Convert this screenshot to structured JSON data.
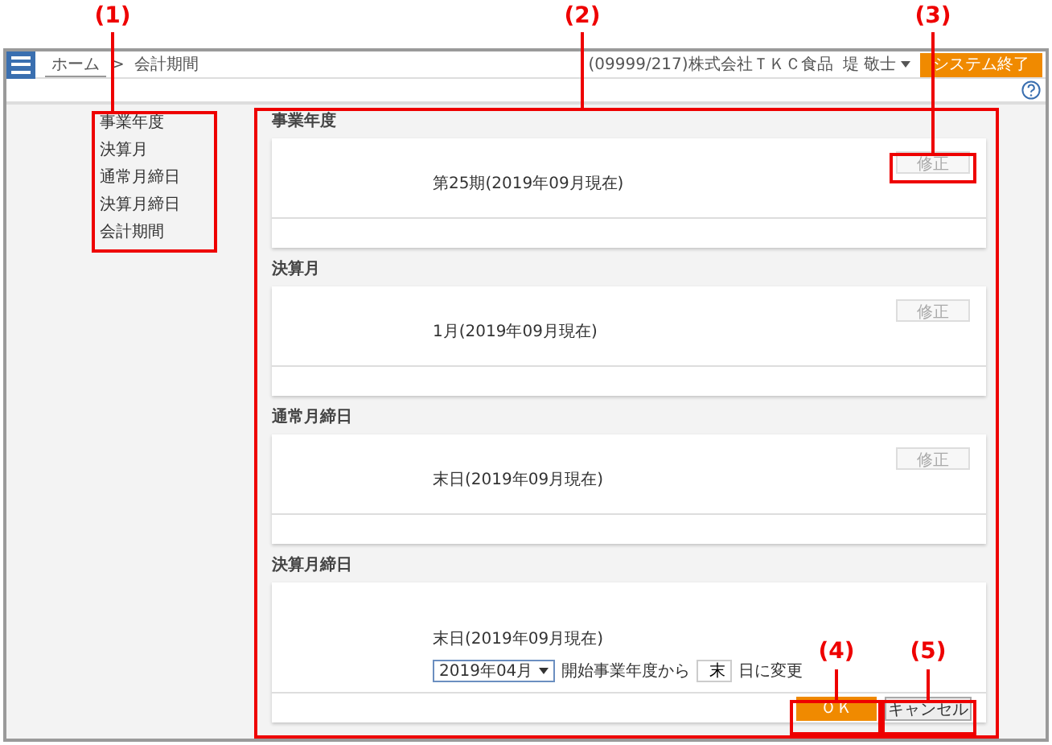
{
  "callouts": [
    {
      "label": "(1)"
    },
    {
      "label": "(2)"
    },
    {
      "label": "(3)"
    },
    {
      "label": "(4)"
    },
    {
      "label": "(5)"
    }
  ],
  "header": {
    "breadcrumb": [
      {
        "label": "ホーム",
        "kind": "link"
      },
      {
        "label": "会計期間",
        "kind": "current"
      }
    ],
    "separator": ">",
    "company": "(09999/217)株式会社ＴＫＣ食品",
    "user": "堤 敬士",
    "exit_button": "システム終了"
  },
  "nav": {
    "items": [
      {
        "label": "事業年度"
      },
      {
        "label": "決算月"
      },
      {
        "label": "通常月締日"
      },
      {
        "label": "決算月締日"
      },
      {
        "label": "会計期間"
      }
    ]
  },
  "sections": [
    {
      "kind": "display",
      "title": "事業年度",
      "value": "第25期(2019年09月現在)",
      "edit_button": "修正",
      "edit_disabled": true
    },
    {
      "kind": "display",
      "title": "決算月",
      "value": "1月(2019年09月現在)",
      "edit_button": "修正",
      "edit_disabled": true
    },
    {
      "kind": "display",
      "title": "通常月締日",
      "value": "末日(2019年09月現在)",
      "edit_button": "修正",
      "edit_disabled": true
    },
    {
      "kind": "editing",
      "title": "決算月締日",
      "value": "末日(2019年09月現在)",
      "select": "2019年04月",
      "from_text": "開始事業年度から",
      "day_value": "末",
      "suffix": "日に変更",
      "ok_button": "ＯＫ",
      "cancel_button": "キャンセル"
    }
  ]
}
